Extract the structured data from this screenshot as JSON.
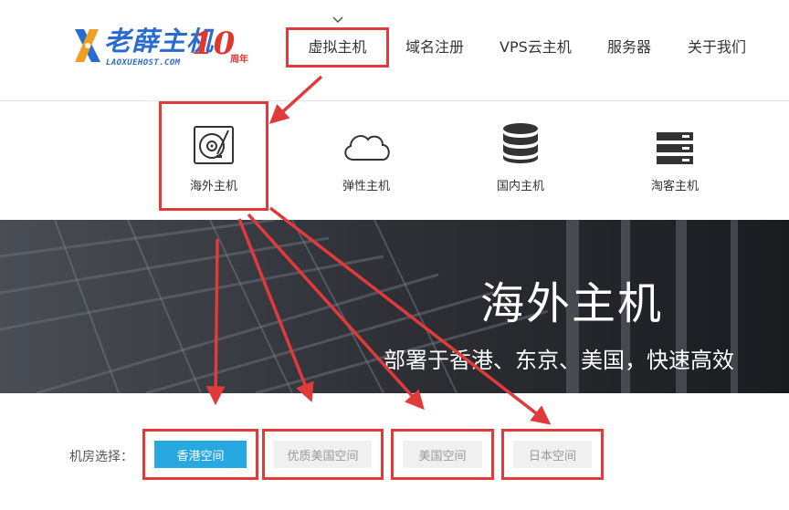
{
  "logo": {
    "text": "老薛主机",
    "sub": "LAOXUEHOST.COM",
    "anniversary": "10",
    "anniversary_label": "周年"
  },
  "nav": [
    {
      "label": "虚拟主机"
    },
    {
      "label": "域名注册"
    },
    {
      "label": "VPS云主机"
    },
    {
      "label": "服务器"
    },
    {
      "label": "关于我们"
    }
  ],
  "submenu": [
    {
      "label": "海外主机",
      "icon": "disk-icon"
    },
    {
      "label": "弹性主机",
      "icon": "cloud-icon"
    },
    {
      "label": "国内主机",
      "icon": "database-icon"
    },
    {
      "label": "淘客主机",
      "icon": "server-rack-icon"
    }
  ],
  "banner": {
    "title": "海外主机",
    "subtitle": "部署于香港、东京、美国，快速高效"
  },
  "filter": {
    "label": "机房选择：",
    "tabs": [
      {
        "label": "香港空间",
        "selected": true
      },
      {
        "label": "优质美国空间",
        "selected": false
      },
      {
        "label": "美国空间",
        "selected": false
      },
      {
        "label": "日本空间",
        "selected": false
      }
    ]
  },
  "colors": {
    "highlight": "#e03a3a",
    "primary": "#27a8e0",
    "brand": "#2a6bd1"
  }
}
